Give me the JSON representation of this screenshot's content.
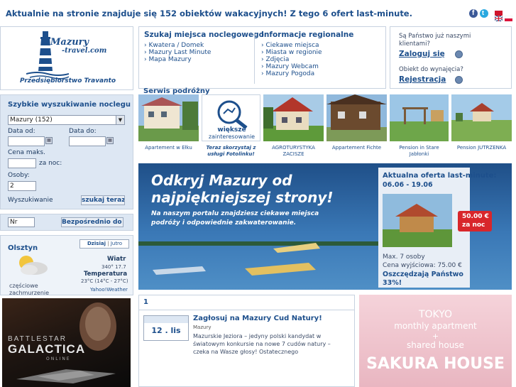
{
  "top": {
    "message": "Aktualnie na stronie znajduje się 152 obiektów wakacyjnych! Z tego 6 ofert last-minute.",
    "social": [
      "facebook-icon",
      "twitter-icon"
    ],
    "flags": [
      "uk-flag-icon",
      "pl-flag-icon"
    ]
  },
  "logo": {
    "brand_line1": "Mazury",
    "brand_line2": "-travel.com",
    "subtitle": "Przedsiębiorstwo Travanto"
  },
  "nav": {
    "col1_title": "Szukaj miejsca noclegowego",
    "col1_links": [
      "Kwatera / Domek",
      "Mazury Last Minute",
      "Mapa Mazury"
    ],
    "col2_title": "Informacje regionalne",
    "col2_links": [
      "Ciekawe miejsca",
      "Miasta w regionie",
      "Zdjęcia",
      "Mazury Webcam",
      "Mazury Pogoda"
    ]
  },
  "login": {
    "question": "Są Państwo już naszymi klientami?",
    "question_line1": "Są Państwo już naszymi",
    "question_line2": "klientami?",
    "login_link": "Zaloguj się",
    "owner_question": "Obiekt do wynajęcia?",
    "register_link": "Rejestracja"
  },
  "serwis": "Serwis podróżny",
  "search": {
    "title": "Szybkie wyszukiwanie noclegu",
    "region_value": "Mazury (152)",
    "date_from_label": "Data od:",
    "date_to_label": "Data do:",
    "price_label": "Cena maks.",
    "per_night": "za noc:",
    "persons_label": "Osoby:",
    "persons_value": "2",
    "search_label": "Wyszukiwanie",
    "search_button": "szukaj teraz"
  },
  "direct": {
    "nr_placeholder": "Nr",
    "button": "Bezpośrednio do obiektu"
  },
  "weather": {
    "city": "Olsztyn",
    "tab_today": "Dzisiaj",
    "tab_tomorrow": "Jutro",
    "wind_label": "Wiatr",
    "wind_value": "340° 17.7",
    "temp_label": "Temperatura",
    "temp_value": "23°C (14°C - 27°C)",
    "condition_line1": "częściowe",
    "condition_line2": "zachmurzenie",
    "source": "Yahoo!Weather"
  },
  "ad_left": {
    "title": "BATTLESTAR",
    "title2": "GALACTICA",
    "sub": "ONLINE"
  },
  "thumbs": [
    {
      "caption": "Apartement w Ełku"
    },
    {
      "caption": "Teraz skorzystaj z usługi Fotolinku!",
      "promo_line1": "większe",
      "promo_line2": "zainteresowanie"
    },
    {
      "caption": "AGROTURYSTYKA ZACISZE"
    },
    {
      "caption": "Appartement Fichte"
    },
    {
      "caption": "Pension in Stare Jabłonki"
    },
    {
      "caption": "Pension JUTRZENKA"
    }
  ],
  "banner": {
    "headline1": "Odkryj Mazury od",
    "headline2": "najpiękniejszej strony!",
    "text1": "Na naszym portalu znajdziesz ciekawe miejsca",
    "text2": "podróży i odpowiednie zakwaterowanie."
  },
  "offer": {
    "title": "Aktualna oferta last-minute:",
    "dates": "06.06 - 19.06",
    "price_badge1": "50.00 €",
    "price_badge2": "za noc",
    "max_persons": "Max. 7 osoby",
    "start_price": "Cena wyjściowa: 75.00 €",
    "savings1": "Oszczędzają Państwo",
    "savings2": "33%!"
  },
  "news": {
    "page": "1",
    "date": "12 . lis",
    "title": "Zagłosuj na Mazury Cud Natury!",
    "category": "Mazury",
    "body1": "Mazurskie Jeziora – jedyny polski kandydat w",
    "body2": "światowym konkursie na nowe 7 cudów natury –",
    "body3": "czeka na Wasze głosy! Ostatecznego"
  },
  "ad_right": {
    "line1": "TOKYO",
    "line2": "monthly apartment",
    "line3": "+",
    "line4": "shared house",
    "line5": "SAKURA HOUSE"
  },
  "colors": {
    "brand": "#1d4f8c",
    "panel": "#dde7f3",
    "banner": "#2a5f98",
    "badge": "#d8262b"
  }
}
